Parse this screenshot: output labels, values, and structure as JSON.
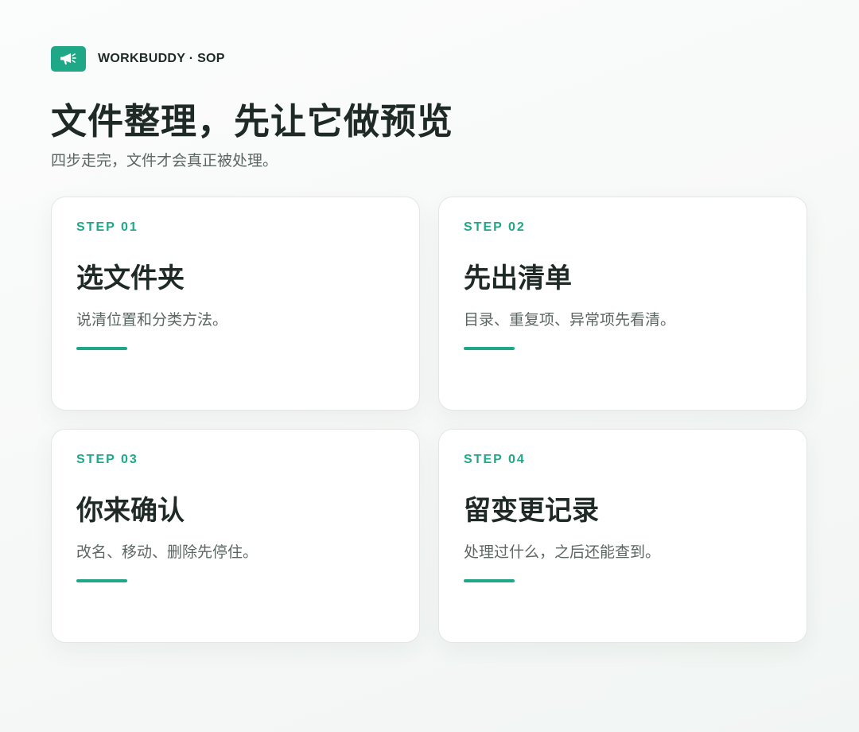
{
  "brand": {
    "name": "WORKBUDDY · SOP",
    "logo_icon": "megaphone-icon",
    "accent_color": "#1fa888"
  },
  "header": {
    "title": "文件整理，先让它做预览",
    "subtitle": "四步走完，文件才会真正被处理。"
  },
  "steps": [
    {
      "label": "STEP 01",
      "title": "选文件夹",
      "description": "说清位置和分类方法。"
    },
    {
      "label": "STEP 02",
      "title": "先出清单",
      "description": "目录、重复项、异常项先看清。"
    },
    {
      "label": "STEP 03",
      "title": "你来确认",
      "description": "改名、移动、删除先停住。"
    },
    {
      "label": "STEP 04",
      "title": "留变更记录",
      "description": "处理过什么，之后还能查到。"
    }
  ]
}
